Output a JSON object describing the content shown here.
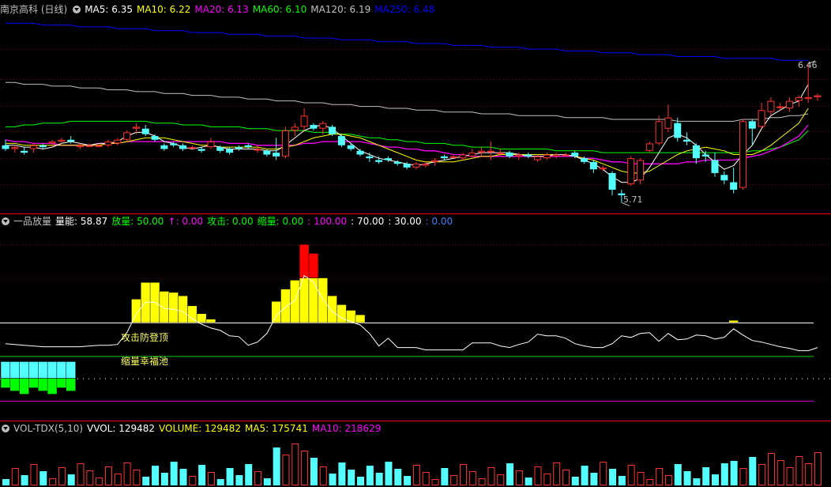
{
  "main": {
    "title": "南京高科 (日线)",
    "ma": [
      {
        "label": "MA5: 6.35",
        "color": "#ffffff"
      },
      {
        "label": "MA10: 6.22",
        "color": "#ffff00"
      },
      {
        "label": "MA20: 6.13",
        "color": "#ff00ff"
      },
      {
        "label": "MA60: 6.10",
        "color": "#00ff00"
      },
      {
        "label": "MA120: 6.19",
        "color": "#c0c0c0"
      },
      {
        "label": "MA250: 6.48",
        "color": "#0000ff"
      }
    ],
    "high_label": "6.46",
    "low_label": "5.71"
  },
  "indicator": {
    "name": "一品放量",
    "items": [
      {
        "label": "量能: 58.87",
        "color": "#ffffff"
      },
      {
        "label": "放量: 50.00",
        "color": "#00ff00"
      },
      {
        "label": "↑: 0.00",
        "color": "#ff00ff"
      },
      {
        "label": "攻击: 0.00",
        "color": "#00ff00"
      },
      {
        "label": "缩量: 0.00",
        "color": "#00ff00"
      },
      {
        "label": ": 100.00",
        "color": "#ff00ff"
      },
      {
        "label": ": 70.00",
        "color": "#ffffff"
      },
      {
        "label": ": 30.00",
        "color": "#ffffff"
      },
      {
        "label": ": 0.00",
        "color": "#3f7fff"
      }
    ],
    "text1": "攻击防登顶",
    "text2": "缩量幸福池"
  },
  "volume": {
    "name": "VOL-TDX(5,10)",
    "items": [
      {
        "label": "VVOL: 129482",
        "color": "#ffffff"
      },
      {
        "label": "VOLUME: 129482",
        "color": "#ffff00"
      },
      {
        "label": "MA5: 175741",
        "color": "#ffff00"
      },
      {
        "label": "MA10: 218629",
        "color": "#ff00ff"
      }
    ]
  },
  "colors": {
    "up": "#ff3232",
    "down": "#54ffff",
    "grid": "#7a0000",
    "sep": "#ff0000"
  },
  "chart_data": [
    {
      "type": "candlestick",
      "title": "南京高科 (日线)",
      "ohlc": [
        [
          6.02,
          6.05,
          5.99,
          6.0
        ],
        [
          6.0,
          6.02,
          5.98,
          6.01
        ],
        [
          5.99,
          6.01,
          5.97,
          5.98
        ],
        [
          6.0,
          6.03,
          5.98,
          6.02
        ],
        [
          6.02,
          6.03,
          6.0,
          6.01
        ],
        [
          6.03,
          6.05,
          6.01,
          6.04
        ],
        [
          6.04,
          6.06,
          6.03,
          6.05
        ],
        [
          6.05,
          6.07,
          6.03,
          6.04
        ],
        [
          6.01,
          6.03,
          6.0,
          6.02
        ],
        [
          6.02,
          6.03,
          6.01,
          6.02
        ],
        [
          6.02,
          6.03,
          6.01,
          6.02
        ],
        [
          6.02,
          6.05,
          6.01,
          6.04
        ],
        [
          6.03,
          6.06,
          6.02,
          6.05
        ],
        [
          6.05,
          6.1,
          6.04,
          6.09
        ],
        [
          6.11,
          6.14,
          6.08,
          6.12
        ],
        [
          6.11,
          6.13,
          6.07,
          6.08
        ],
        [
          6.07,
          6.08,
          6.04,
          6.05
        ],
        [
          6.02,
          6.03,
          5.99,
          6.0
        ],
        [
          6.03,
          6.04,
          6.01,
          6.02
        ],
        [
          6.02,
          6.03,
          5.99,
          6.0
        ],
        [
          6.01,
          6.02,
          6.0,
          6.01
        ],
        [
          6.0,
          6.01,
          5.98,
          5.99
        ],
        [
          6.01,
          6.06,
          6.0,
          6.04
        ],
        [
          6.01,
          6.02,
          5.98,
          5.99
        ],
        [
          6.0,
          6.01,
          5.97,
          5.98
        ],
        [
          6.01,
          6.02,
          5.99,
          6.0
        ],
        [
          6.02,
          6.03,
          6.0,
          6.01
        ],
        [
          6.0,
          6.02,
          5.98,
          6.0
        ],
        [
          5.99,
          6.0,
          5.96,
          5.97
        ],
        [
          5.98,
          6.06,
          5.94,
          5.96
        ],
        [
          5.96,
          6.12,
          5.95,
          6.1
        ],
        [
          6.1,
          6.14,
          6.07,
          6.12
        ],
        [
          6.12,
          6.22,
          6.1,
          6.18
        ],
        [
          6.13,
          6.14,
          6.1,
          6.11
        ],
        [
          6.11,
          6.15,
          6.08,
          6.14
        ],
        [
          6.12,
          6.13,
          6.07,
          6.08
        ],
        [
          6.07,
          6.08,
          6.01,
          6.02
        ],
        [
          6.02,
          6.03,
          5.99,
          6.0
        ],
        [
          5.99,
          6.0,
          5.96,
          5.97
        ],
        [
          5.96,
          5.98,
          5.93,
          5.95
        ],
        [
          5.94,
          5.96,
          5.92,
          5.93
        ],
        [
          5.95,
          5.96,
          5.93,
          5.94
        ],
        [
          5.93,
          5.94,
          5.91,
          5.92
        ],
        [
          5.92,
          5.93,
          5.89,
          5.9
        ],
        [
          5.9,
          5.93,
          5.89,
          5.92
        ],
        [
          5.91,
          5.93,
          5.9,
          5.92
        ],
        [
          5.93,
          5.95,
          5.91,
          5.94
        ],
        [
          5.96,
          5.97,
          5.94,
          5.95
        ],
        [
          5.96,
          5.97,
          5.95,
          5.96
        ],
        [
          5.95,
          5.98,
          5.94,
          5.97
        ],
        [
          5.96,
          6.0,
          5.95,
          5.98
        ],
        [
          5.98,
          6.01,
          5.96,
          5.99
        ],
        [
          5.99,
          6.04,
          5.94,
          5.99
        ],
        [
          5.98,
          6.0,
          5.96,
          5.98
        ],
        [
          5.98,
          5.99,
          5.95,
          5.96
        ],
        [
          5.96,
          5.98,
          5.94,
          5.97
        ],
        [
          5.97,
          5.98,
          5.95,
          5.96
        ],
        [
          5.94,
          5.97,
          5.93,
          5.96
        ],
        [
          5.95,
          5.98,
          5.94,
          5.97
        ],
        [
          5.96,
          5.98,
          5.95,
          5.97
        ],
        [
          5.97,
          5.98,
          5.96,
          5.97
        ],
        [
          5.98,
          5.99,
          5.95,
          5.96
        ],
        [
          5.95,
          5.96,
          5.92,
          5.93
        ],
        [
          5.93,
          5.94,
          5.87,
          5.89
        ],
        [
          5.89,
          5.91,
          5.88,
          5.9
        ],
        [
          5.87,
          5.88,
          5.75,
          5.78
        ],
        [
          5.76,
          5.78,
          5.71,
          5.75
        ],
        [
          5.81,
          5.96,
          5.8,
          5.95
        ],
        [
          5.83,
          5.95,
          5.81,
          5.94
        ],
        [
          5.99,
          6.04,
          5.98,
          6.03
        ],
        [
          6.03,
          6.18,
          6.02,
          6.15
        ],
        [
          6.11,
          6.24,
          6.09,
          6.17
        ],
        [
          6.14,
          6.17,
          6.04,
          6.06
        ],
        [
          6.05,
          6.09,
          6.02,
          6.04
        ],
        [
          6.02,
          6.03,
          5.92,
          5.95
        ],
        [
          5.97,
          5.99,
          5.93,
          5.96
        ],
        [
          5.94,
          5.98,
          5.85,
          5.87
        ],
        [
          5.86,
          5.88,
          5.81,
          5.83
        ],
        [
          5.82,
          5.9,
          5.76,
          5.78
        ],
        [
          5.79,
          6.16,
          5.78,
          6.15
        ],
        [
          6.15,
          6.16,
          6.02,
          6.11
        ],
        [
          6.12,
          6.25,
          6.11,
          6.21
        ],
        [
          6.2,
          6.28,
          6.18,
          6.26
        ],
        [
          6.23,
          6.25,
          6.21,
          6.23
        ],
        [
          6.22,
          6.28,
          6.2,
          6.26
        ],
        [
          6.26,
          6.29,
          6.23,
          6.28
        ],
        [
          6.27,
          6.46,
          6.25,
          6.28
        ],
        [
          6.28,
          6.3,
          6.26,
          6.29
        ]
      ],
      "ma5": [
        6.02,
        6.02,
        6.01,
        6.01,
        6.0,
        6.01,
        6.03,
        6.04,
        6.03,
        6.02,
        6.03,
        6.03,
        6.04,
        6.07,
        6.09,
        6.09,
        6.07,
        6.04,
        6.03,
        6.01,
        6.0,
        6.01,
        6.02,
        6.01,
        6.0,
        6.0,
        6.0,
        6.0,
        5.99,
        5.99,
        6.02,
        6.06,
        6.1,
        6.12,
        6.13,
        6.11,
        6.07,
        6.03,
        5.99,
        5.97,
        5.95,
        5.94,
        5.93,
        5.92,
        5.91,
        5.92,
        5.93,
        5.94,
        5.95,
        5.96,
        5.97,
        5.98,
        5.98,
        5.98,
        5.98,
        5.97,
        5.96,
        5.96,
        5.96,
        5.97,
        5.97,
        5.96,
        5.94,
        5.92,
        5.89,
        5.85,
        5.82,
        5.82,
        5.84,
        5.9,
        5.98,
        6.06,
        6.08,
        6.06,
        6.02,
        5.97,
        5.93,
        5.89,
        5.91,
        5.97,
        6.02,
        6.11,
        6.18,
        6.21,
        6.24,
        6.26,
        6.35
      ],
      "ma10": [
        6.03,
        6.03,
        6.02,
        6.02,
        6.02,
        6.02,
        6.02,
        6.02,
        6.02,
        6.02,
        6.02,
        6.03,
        6.03,
        6.04,
        6.05,
        6.06,
        6.06,
        6.06,
        6.05,
        6.04,
        6.03,
        6.02,
        6.02,
        6.01,
        6.01,
        6.01,
        6.01,
        6.01,
        6.0,
        6.0,
        6.01,
        6.02,
        6.04,
        6.06,
        6.07,
        6.08,
        6.08,
        6.07,
        6.06,
        6.04,
        6.02,
        6.0,
        5.98,
        5.96,
        5.94,
        5.93,
        5.93,
        5.93,
        5.93,
        5.94,
        5.95,
        5.96,
        5.96,
        5.97,
        5.97,
        5.97,
        5.97,
        5.97,
        5.97,
        5.97,
        5.97,
        5.96,
        5.95,
        5.94,
        5.92,
        5.9,
        5.88,
        5.87,
        5.87,
        5.88,
        5.91,
        5.94,
        5.97,
        5.99,
        6.0,
        6.01,
        6.0,
        5.99,
        5.97,
        5.97,
        5.97,
        5.99,
        6.02,
        6.06,
        6.1,
        6.14,
        6.22
      ],
      "ma20": [
        6.05,
        6.04,
        6.04,
        6.03,
        6.03,
        6.03,
        6.02,
        6.02,
        6.02,
        6.02,
        6.03,
        6.03,
        6.03,
        6.04,
        6.04,
        6.04,
        6.04,
        6.04,
        6.04,
        6.04,
        6.04,
        6.04,
        6.04,
        6.04,
        6.03,
        6.03,
        6.03,
        6.02,
        6.02,
        6.02,
        6.02,
        6.02,
        6.03,
        6.03,
        6.04,
        6.04,
        6.04,
        6.04,
        6.04,
        6.03,
        6.02,
        6.01,
        6.01,
        6.0,
        6.0,
        5.99,
        5.99,
        5.98,
        5.97,
        5.97,
        5.96,
        5.96,
        5.96,
        5.96,
        5.96,
        5.96,
        5.96,
        5.96,
        5.96,
        5.96,
        5.96,
        5.96,
        5.95,
        5.95,
        5.94,
        5.93,
        5.93,
        5.92,
        5.92,
        5.92,
        5.92,
        5.92,
        5.92,
        5.93,
        5.93,
        5.94,
        5.94,
        5.94,
        5.94,
        5.95,
        5.96,
        5.97,
        5.99,
        6.01,
        6.04,
        6.07,
        6.13
      ],
      "ma60": [
        6.12,
        6.12,
        6.13,
        6.13,
        6.14,
        6.14,
        6.14,
        6.15,
        6.15,
        6.15,
        6.15,
        6.15,
        6.15,
        6.15,
        6.15,
        6.15,
        6.14,
        6.14,
        6.14,
        6.13,
        6.13,
        6.13,
        6.12,
        6.12,
        6.12,
        6.12,
        6.11,
        6.11,
        6.11,
        6.1,
        6.1,
        6.1,
        6.1,
        6.09,
        6.09,
        6.09,
        6.08,
        6.08,
        6.07,
        6.06,
        6.06,
        6.05,
        6.05,
        6.04,
        6.04,
        6.03,
        6.03,
        6.03,
        6.02,
        6.02,
        6.01,
        6.01,
        6.01,
        6.0,
        6.0,
        6.0,
        6.0,
        6.0,
        6.0,
        5.99,
        5.99,
        5.99,
        5.99,
        5.99,
        5.98,
        5.98,
        5.98,
        5.98,
        5.98,
        5.98,
        5.98,
        5.98,
        5.98,
        5.98,
        5.98,
        5.98,
        5.98,
        5.98,
        5.98,
        5.98,
        5.99,
        5.99,
        6.0,
        6.01,
        6.03,
        6.05,
        6.1
      ],
      "ma120": [
        6.36,
        6.36,
        6.35,
        6.35,
        6.35,
        6.34,
        6.34,
        6.34,
        6.33,
        6.33,
        6.33,
        6.32,
        6.32,
        6.32,
        6.31,
        6.31,
        6.31,
        6.3,
        6.3,
        6.3,
        6.29,
        6.29,
        6.29,
        6.28,
        6.28,
        6.28,
        6.27,
        6.27,
        6.27,
        6.26,
        6.26,
        6.26,
        6.25,
        6.25,
        6.25,
        6.24,
        6.24,
        6.24,
        6.23,
        6.23,
        6.23,
        6.22,
        6.22,
        6.22,
        6.21,
        6.21,
        6.21,
        6.2,
        6.2,
        6.2,
        6.2,
        6.19,
        6.19,
        6.19,
        6.19,
        6.18,
        6.18,
        6.18,
        6.18,
        6.18,
        6.17,
        6.17,
        6.17,
        6.17,
        6.17,
        6.16,
        6.16,
        6.16,
        6.16,
        6.16,
        6.16,
        6.16,
        6.15,
        6.15,
        6.15,
        6.15,
        6.15,
        6.15,
        6.15,
        6.16,
        6.16,
        6.16,
        6.17,
        6.17,
        6.18,
        6.18,
        6.19
      ],
      "ma250": [
        6.68,
        6.68,
        6.68,
        6.68,
        6.67,
        6.67,
        6.67,
        6.67,
        6.66,
        6.66,
        6.66,
        6.66,
        6.65,
        6.65,
        6.65,
        6.65,
        6.64,
        6.64,
        6.64,
        6.64,
        6.63,
        6.63,
        6.63,
        6.63,
        6.62,
        6.62,
        6.62,
        6.62,
        6.61,
        6.61,
        6.61,
        6.61,
        6.6,
        6.6,
        6.6,
        6.6,
        6.59,
        6.59,
        6.59,
        6.59,
        6.58,
        6.58,
        6.58,
        6.58,
        6.57,
        6.57,
        6.57,
        6.57,
        6.56,
        6.56,
        6.56,
        6.56,
        6.55,
        6.55,
        6.55,
        6.55,
        6.54,
        6.54,
        6.54,
        6.54,
        6.53,
        6.53,
        6.53,
        6.53,
        6.52,
        6.52,
        6.52,
        6.52,
        6.51,
        6.51,
        6.51,
        6.51,
        6.5,
        6.5,
        6.5,
        6.5,
        6.5,
        6.49,
        6.49,
        6.49,
        6.49,
        6.49,
        6.49,
        6.48,
        6.48,
        6.48,
        6.48
      ],
      "ylim": [
        5.66,
        6.72
      ],
      "high": 6.46,
      "low": 5.71
    },
    {
      "type": "bar",
      "title": "一品放量",
      "energy": [
        13,
        12,
        11,
        10,
        9,
        9,
        9,
        9,
        9,
        10,
        11,
        11,
        12,
        27,
        51,
        66,
        66,
        58,
        57,
        54,
        45,
        38,
        33,
        30,
        23,
        22,
        11,
        15,
        26,
        49,
        60,
        68,
        100,
        92,
        70,
        54,
        46,
        41,
        37,
        26,
        10,
        20,
        8,
        8,
        8,
        5,
        5,
        5,
        5,
        5,
        14,
        14,
        14,
        10,
        8,
        12,
        15,
        25,
        23,
        23,
        20,
        13,
        10,
        8,
        8,
        13,
        23,
        21,
        26,
        27,
        16,
        26,
        18,
        19,
        24,
        23,
        19,
        21,
        32,
        24,
        17,
        15,
        12,
        9,
        7,
        4,
        4,
        8
      ],
      "fill_top": [
        0,
        0,
        0,
        0,
        0,
        0,
        0,
        0,
        0,
        0,
        0,
        0,
        0,
        0,
        0,
        0,
        0,
        0,
        0,
        0,
        0,
        0,
        0,
        0,
        0,
        0,
        0,
        0,
        0,
        0,
        0,
        0,
        0,
        0,
        0,
        0,
        0,
        0,
        0,
        0,
        0,
        0,
        0,
        0,
        0,
        0,
        0,
        0,
        0,
        0,
        0,
        0,
        0,
        0,
        0,
        0,
        0,
        0,
        0,
        0,
        0,
        0,
        0,
        0,
        0,
        0,
        0,
        0,
        0,
        0,
        0,
        0,
        0,
        0,
        0,
        0,
        0,
        0,
        0,
        0,
        0,
        0,
        0,
        0,
        0,
        0,
        0,
        0
      ],
      "ref_lines": [
        100,
        70,
        30,
        0
      ],
      "ylim": [
        -55,
        115
      ]
    },
    {
      "type": "bar",
      "title": "VOL-TDX(5,10)",
      "ylim": [
        0,
        520000
      ]
    }
  ]
}
